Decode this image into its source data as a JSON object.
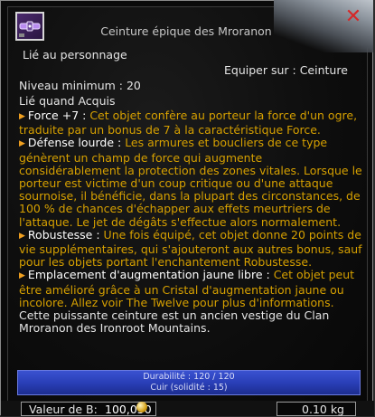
{
  "window": {
    "title": "Ceinture épique des Mroranon",
    "close_icon": "close-icon"
  },
  "item": {
    "icon": "belt-icon",
    "bound": "Lié au personnage",
    "equip": "Equiper sur : Ceinture",
    "level": "Niveau minimum : 20",
    "acquire": "Lié quand Acquis"
  },
  "effects": [
    {
      "label": "Force +7 :",
      "desc": "Cet objet confère au porteur la force d'un ogre, traduite par un bonus de 7 à la caractéristique Force."
    },
    {
      "label": "Défense lourde :",
      "desc": "Les armures et boucliers de ce type génèrent un champ de force qui augmente considérablement la protection des zones vitales. Lorsque le porteur est victime d'un coup critique ou d'une attaque sournoise, il bénéficie, dans la plupart des circonstances, de 100 % de chances d'échapper aux effets meurtriers de l'attaque. Le jet de dégâts s'effectue alors normalement."
    },
    {
      "label": "Robustesse :",
      "desc": "Une fois équipé, cet objet donne 20 points de vie supplémentaires, qui s'ajouteront aux autres bonus, sauf pour les objets portant l'enchantement Robustesse."
    },
    {
      "label": "Emplacement d'augmentation jaune libre :",
      "desc": "Cet objet peut être amélioré grâce à un Cristal d'augmentation jaune ou incolore. Allez voir The Twelve pour plus d'informations."
    }
  ],
  "flavor": "Cette puissante ceinture est un ancien vestige du Clan Mroranon des Ironroot Mountains.",
  "durability": {
    "line1": "Durabilité : 120 / 120",
    "line2": "Cuir (solidité : 15)",
    "fraction": 1.0
  },
  "footer": {
    "value_label": "Valeur de B:",
    "value": "100,050",
    "weight": "0.10 kg"
  },
  "colors": {
    "accent": "#d6a000",
    "bar": "#2a3fb8",
    "close": "#d62828"
  }
}
